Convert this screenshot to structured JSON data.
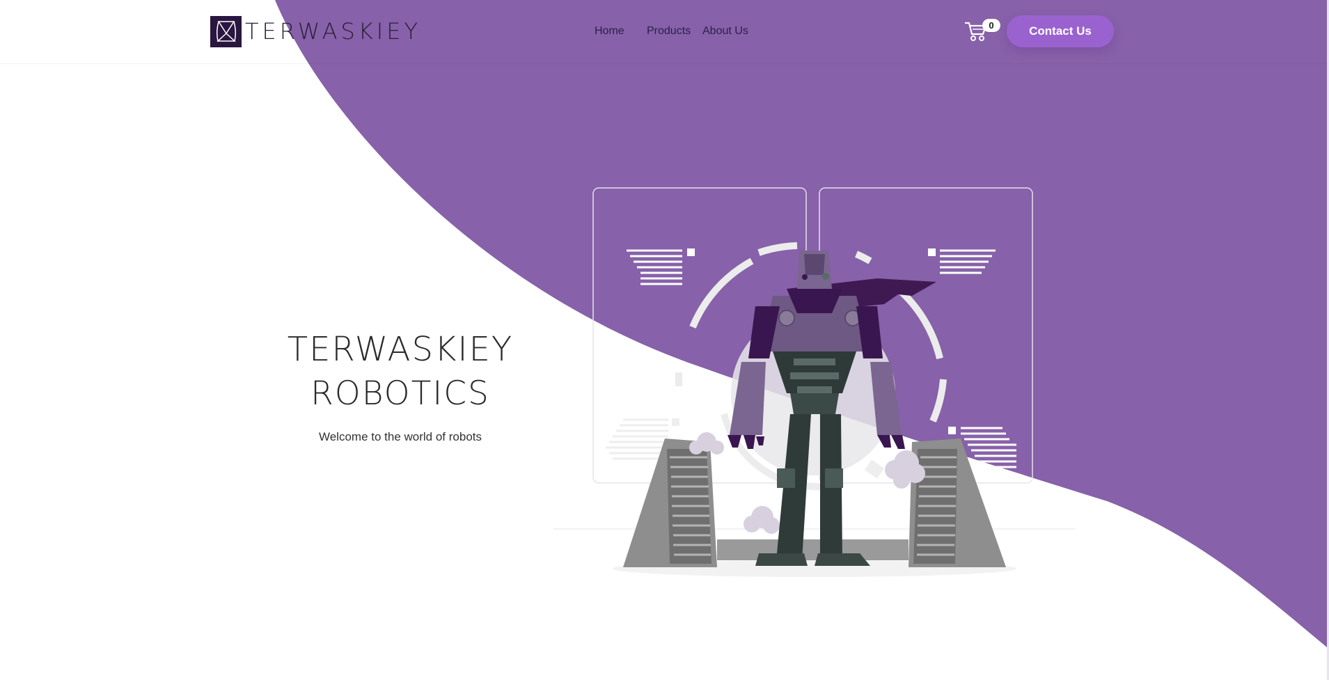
{
  "colors": {
    "brand_purple": "#8761a9",
    "button_purple": "#9a62cf",
    "logo_dark": "#2a1640",
    "text_dark": "#2a1f4a"
  },
  "header": {
    "logo_text": "TERWASKIEY",
    "nav": [
      {
        "label": "Home"
      },
      {
        "label": "Products"
      },
      {
        "label": "About Us"
      }
    ],
    "cart_count": "0",
    "contact_label": "Contact Us"
  },
  "hero": {
    "title_line1": "TERWASKIEY",
    "title_line2": "ROBOTICS",
    "subtitle": "Welcome to the world of robots"
  },
  "icons": [
    "logo-mark-icon",
    "cart-icon"
  ]
}
